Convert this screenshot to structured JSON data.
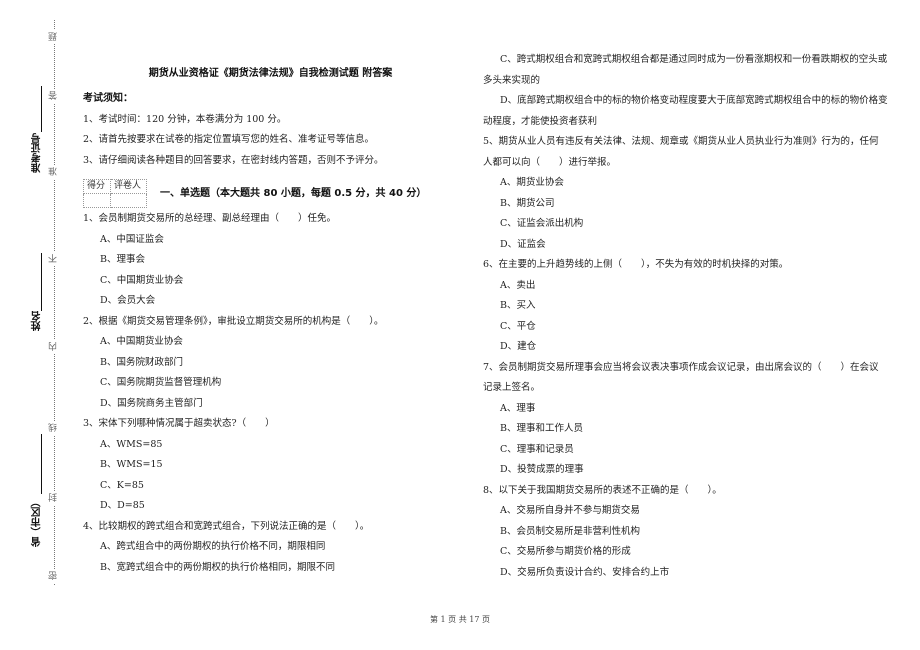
{
  "binding": {
    "seal_chars": [
      "题",
      "答",
      "准",
      "不",
      "内",
      "线",
      "封",
      "密"
    ],
    "fields": [
      {
        "label": "准考证号"
      },
      {
        "label": "姓名"
      },
      {
        "label": "省（市区）"
      }
    ]
  },
  "document": {
    "title": "期货从业资格证《期货法律法规》自我检测试题 附答案",
    "notice": {
      "heading": "考试须知：",
      "items": [
        "1、考试时间：120 分钟，本卷满分为 100 分。",
        "2、请首先按要求在试卷的指定位置填写您的姓名、准考证号等信息。",
        "3、请仔细阅读各种题目的回答要求，在密封线内答题，否则不予评分。"
      ]
    },
    "score_table": {
      "headers": [
        "得分",
        "评卷人"
      ]
    },
    "section_title": "一、单选题（本大题共 80 小题，每题 0.5 分，共 40 分）",
    "left_questions": [
      {
        "stem": "1、会员制期货交易所的总经理、副总经理由（　　）任免。",
        "options": [
          "A、中国证监会",
          "B、理事会",
          "C、中国期货业协会",
          "D、会员大会"
        ]
      },
      {
        "stem": "2、根据《期货交易管理条例》，审批设立期货交易所的机构是（　　）。",
        "options": [
          "A、中国期货业协会",
          "B、国务院财政部门",
          "C、国务院期货监督管理机构",
          "D、国务院商务主管部门"
        ]
      },
      {
        "stem": "3、宋体下列哪种情况属于超卖状态?（　　）",
        "options": [
          "A、WMS=85",
          "B、WMS=15",
          "C、K=85",
          "D、D=85"
        ]
      },
      {
        "stem": "4、比较期权的跨式组合和宽跨式组合，下列说法正确的是（　　）。",
        "options": [
          "A、跨式组合中的两份期权的执行价格不同，期限相同",
          "B、宽跨式组合中的两份期权的执行价格相同，期限不同"
        ]
      }
    ],
    "right_continuation": [
      "C、跨式期权组合和宽跨式期权组合都是通过同时成为一份看涨期权和一份看跌期权的空头或多头来实现的",
      "D、底部跨式期权组合中的标的物价格变动程度要大于底部宽跨式期权组合中的标的物价格变动程度，才能使投资者获利"
    ],
    "right_questions": [
      {
        "stem": "5、期货从业人员有违反有关法律、法规、规章或《期货从业人员执业行为准则》行为的，任何人都可以向（　　）进行举报。",
        "options": [
          "A、期货业协会",
          "B、期货公司",
          "C、证监会派出机构",
          "D、证监会"
        ]
      },
      {
        "stem": "6、在主要的上升趋势线的上侧（　　），不失为有效的时机抉择的对策。",
        "options": [
          "A、卖出",
          "B、买入",
          "C、平仓",
          "D、建仓"
        ]
      },
      {
        "stem": "7、会员制期货交易所理事会应当将会议表决事项作成会议记录，由出席会议的（　　）在会议记录上签名。",
        "options": [
          "A、理事",
          "B、理事和工作人员",
          "C、理事和记录员",
          "D、投赞成票的理事"
        ]
      },
      {
        "stem": "8、以下关于我国期货交易所的表述不正确的是（　　）。",
        "options": [
          "A、交易所自身并不参与期货交易",
          "B、会员制交易所是非营利性机构",
          "C、交易所参与期货价格的形成",
          "D、交易所负责设计合约、安排合约上市"
        ]
      }
    ],
    "footer": "第 1 页 共 17 页"
  }
}
